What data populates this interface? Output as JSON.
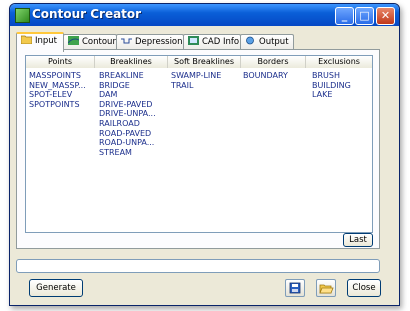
{
  "window": {
    "title": "Contour Creator"
  },
  "title_buttons": {
    "minimize": "_",
    "maximize": "□",
    "close": "✕"
  },
  "tabs": [
    {
      "label": "Input",
      "icon": "folder-icon",
      "active": true
    },
    {
      "label": "Contour",
      "icon": "contour-icon",
      "active": false
    },
    {
      "label": "Depression",
      "icon": "depression-icon",
      "active": false
    },
    {
      "label": "CAD Info",
      "icon": "cad-info-icon",
      "active": false
    },
    {
      "label": "Output",
      "icon": "output-icon",
      "active": false
    }
  ],
  "columns": [
    {
      "header": "Points",
      "items": [
        "MASSPOINTS",
        "NEW_MASSP...",
        "SPOT-ELEV",
        "SPOTPOINTS"
      ]
    },
    {
      "header": "Breaklines",
      "items": [
        "BREAKLINE",
        "BRIDGE",
        "DAM",
        "DRIVE-PAVED",
        "DRIVE-UNPA...",
        "RAILROAD",
        "ROAD-PAVED",
        "ROAD-UNPA...",
        "STREAM"
      ]
    },
    {
      "header": "Soft Breaklines",
      "items": [
        "SWAMP-LINE",
        "TRAIL"
      ]
    },
    {
      "header": "Borders",
      "items": [
        "BOUNDARY"
      ]
    },
    {
      "header": "Exclusions",
      "items": [
        "BRUSH",
        "BUILDING",
        "LAKE"
      ]
    }
  ],
  "buttons": {
    "last": "Last",
    "generate": "Generate",
    "close": "Close"
  },
  "status_text": "",
  "colors": {
    "titlebar": "#0a5fd8",
    "list_text": "#1b2e8c",
    "active_tab_accent": "#ffc83c"
  }
}
